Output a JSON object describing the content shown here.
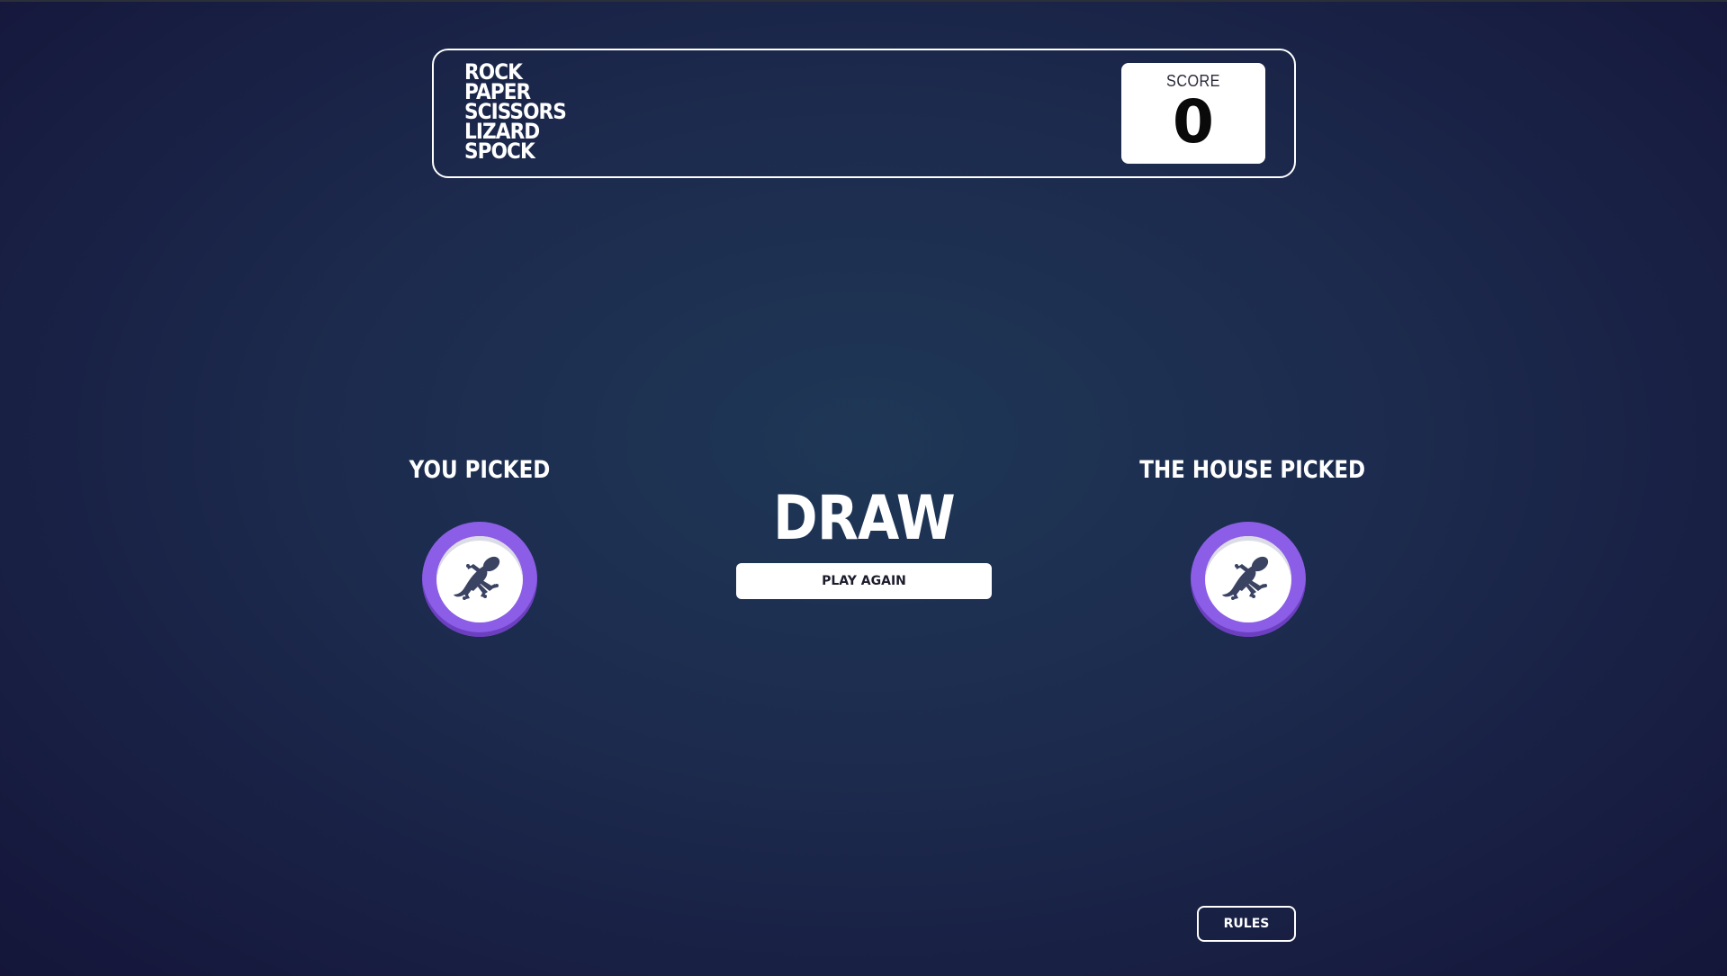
{
  "header": {
    "title_lines": [
      "ROCK",
      "PAPER",
      "SCISSORS",
      "LIZARD",
      "SPOCK"
    ],
    "score_label": "SCORE",
    "score_value": "0"
  },
  "game": {
    "you_label": "YOU PICKED",
    "house_label": "THE HOUSE PICKED",
    "you_pick": "lizard",
    "house_pick": "lizard",
    "result": "DRAW",
    "play_again_label": "PLAY AGAIN",
    "token_color": "#8c5de6"
  },
  "footer": {
    "rules_label": "RULES"
  },
  "colors": {
    "background_center": "#1f3756",
    "background_edge": "#141539",
    "lizard_ring": "#8c5de6",
    "icon_fill": "#3b4363"
  }
}
